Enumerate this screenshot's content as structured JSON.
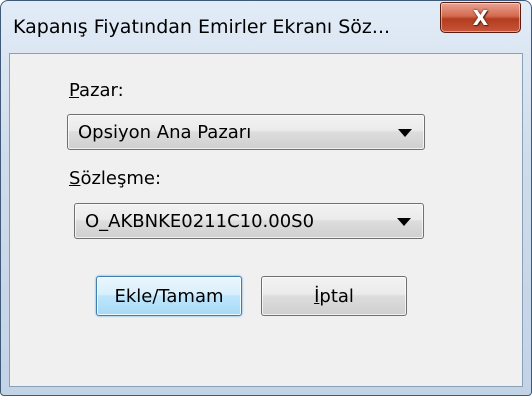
{
  "window": {
    "title": "Kapanış Fiyatından Emirler Ekranı Söz...",
    "close_glyph": "X"
  },
  "form": {
    "market": {
      "label_accel": "P",
      "label_rest": "azar:",
      "selected": "Opsiyon Ana Pazarı"
    },
    "contract": {
      "label_accel": "S",
      "label_rest": "özleşme:",
      "selected": "O_AKBNKE0211C10.00S0"
    }
  },
  "buttons": {
    "ok_label": "Ekle/Tamam",
    "cancel_accel": "İ",
    "cancel_rest": "ptal"
  }
}
